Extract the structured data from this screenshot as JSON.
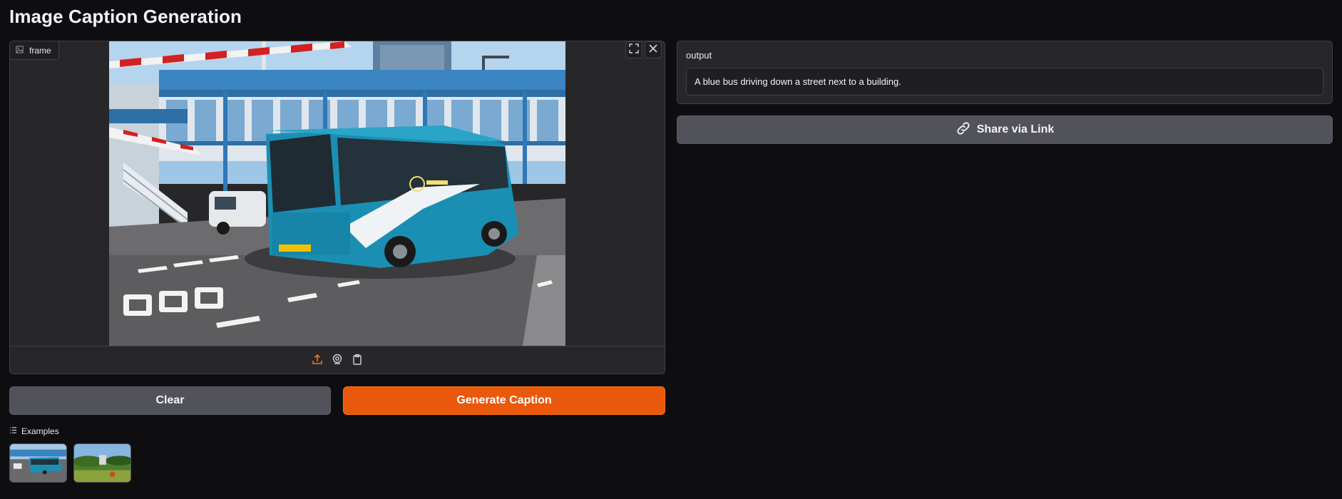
{
  "page": {
    "title": "Image Caption Generation"
  },
  "image_input": {
    "label": "frame",
    "label_icon": "image-icon",
    "controls": [
      "fullscreen-icon",
      "close-icon"
    ],
    "sources": [
      "upload-icon",
      "webcam-icon",
      "clipboard-icon"
    ],
    "accent_color": "#f97316"
  },
  "buttons": {
    "clear_label": "Clear",
    "generate_label": "Generate Caption",
    "generate_color": "#ea580c"
  },
  "examples": {
    "label": "Examples",
    "items": [
      "bus-example",
      "landscape-example"
    ]
  },
  "output": {
    "label": "output",
    "value": "A blue bus driving down a street next to a building."
  },
  "share": {
    "label": "Share via Link",
    "icon": "link-icon"
  }
}
